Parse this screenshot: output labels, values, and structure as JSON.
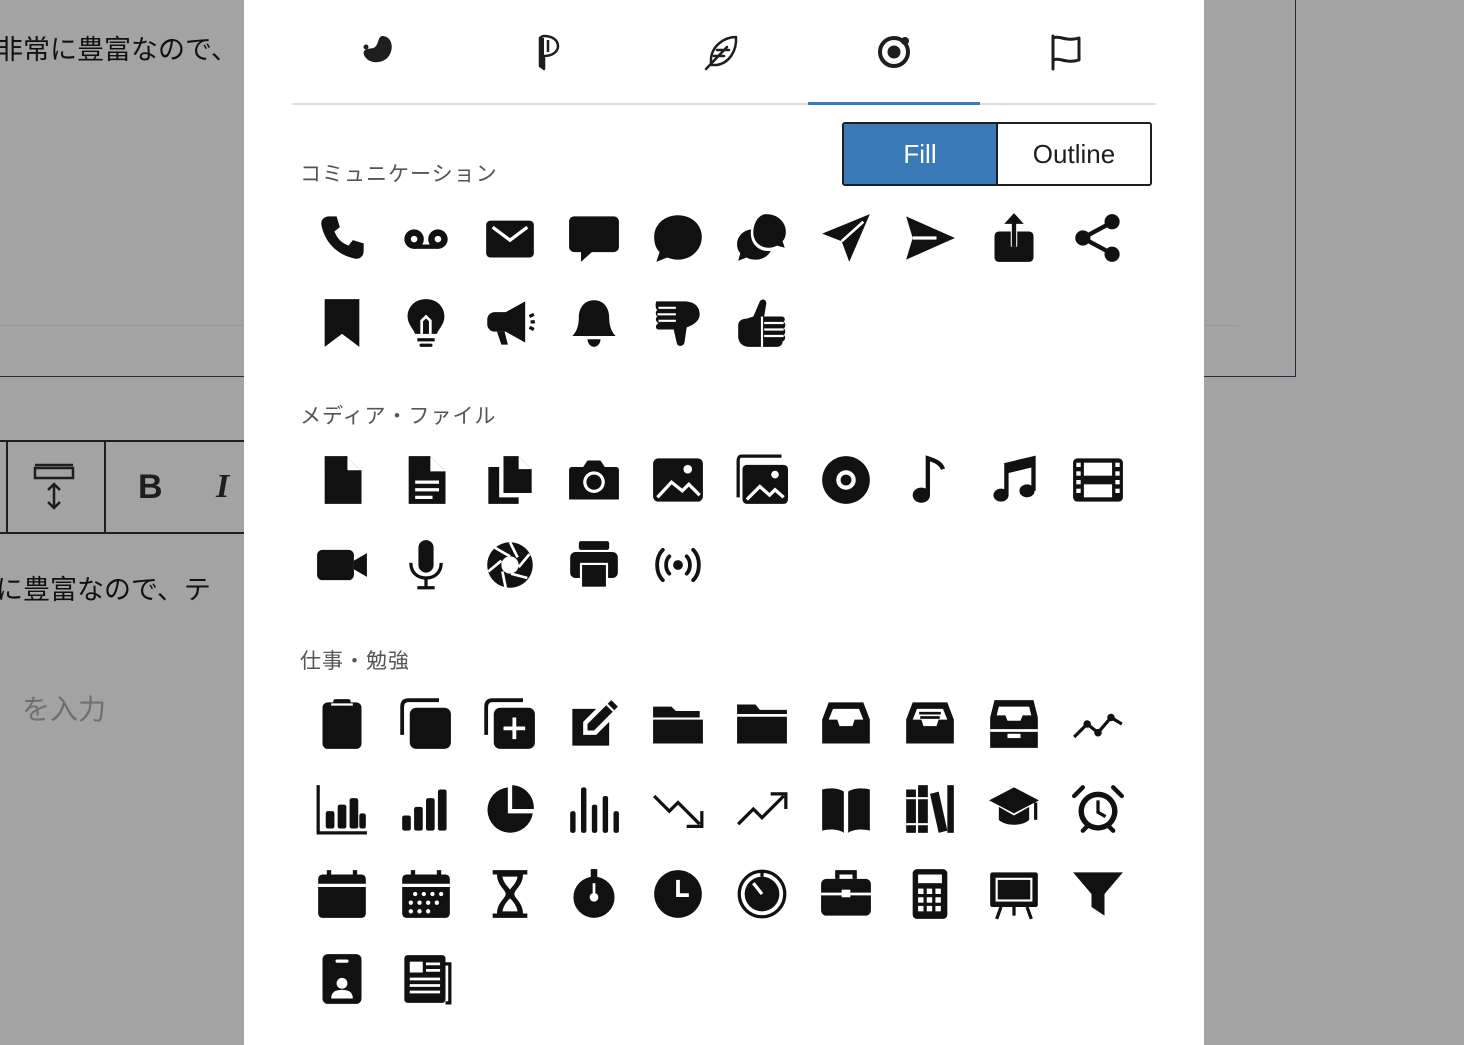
{
  "background": {
    "text_top": "非常に豊富なので、",
    "text_mid": "に豊富なので、テ",
    "placeholder": "を入力",
    "toolbar": {
      "bold_label": "B",
      "italic_label": "I"
    }
  },
  "tabs": [
    {
      "icon": "moon-drop-icon"
    },
    {
      "icon": "leaf-p-icon"
    },
    {
      "icon": "feather-icon"
    },
    {
      "icon": "ionic-icon",
      "active": true
    },
    {
      "icon": "flag-icon"
    }
  ],
  "style_toggle": {
    "fill_label": "Fill",
    "outline_label": "Outline",
    "selected": "Fill"
  },
  "sections": [
    {
      "title": "コミュニケーション",
      "icons": [
        "phone-icon",
        "voicemail-icon",
        "mail-icon",
        "chat-square-icon",
        "chat-bubble-icon",
        "chats-icon",
        "paper-plane-icon",
        "send-icon",
        "share-upload-icon",
        "share-nodes-icon",
        "bookmark-icon",
        "lightbulb-icon",
        "megaphone-icon",
        "bell-icon",
        "thumbs-down-icon",
        "thumbs-up-icon"
      ]
    },
    {
      "title": "メディア・ファイル",
      "icons": [
        "file-icon",
        "file-text-icon",
        "files-icon",
        "camera-icon",
        "image-icon",
        "images-icon",
        "disc-icon",
        "music-note-icon",
        "music-notes-icon",
        "film-strip-icon",
        "video-camera-icon",
        "microphone-icon",
        "aperture-icon",
        "printer-icon",
        "broadcast-icon"
      ]
    },
    {
      "title": "仕事・勉強",
      "icons": [
        "clipboard-icon",
        "copy-icon",
        "copy-plus-icon",
        "note-pencil-icon",
        "folder-open-icon",
        "folder-icon",
        "tray-icon",
        "tray-full-icon",
        "archive-box-icon",
        "line-chart-icon",
        "bar-chart-icon",
        "signal-bars-icon",
        "pie-chart-icon",
        "bar-graph-icon",
        "trend-down-icon",
        "trend-up-icon",
        "book-open-icon",
        "books-icon",
        "graduation-cap-icon",
        "alarm-clock-icon",
        "calendar-blank-icon",
        "calendar-dots-icon",
        "hourglass-icon",
        "stopwatch-icon",
        "clock-icon",
        "timer-icon",
        "briefcase-icon",
        "calculator-icon",
        "presentation-icon",
        "funnel-icon",
        "id-badge-icon",
        "newspaper-icon"
      ]
    }
  ]
}
